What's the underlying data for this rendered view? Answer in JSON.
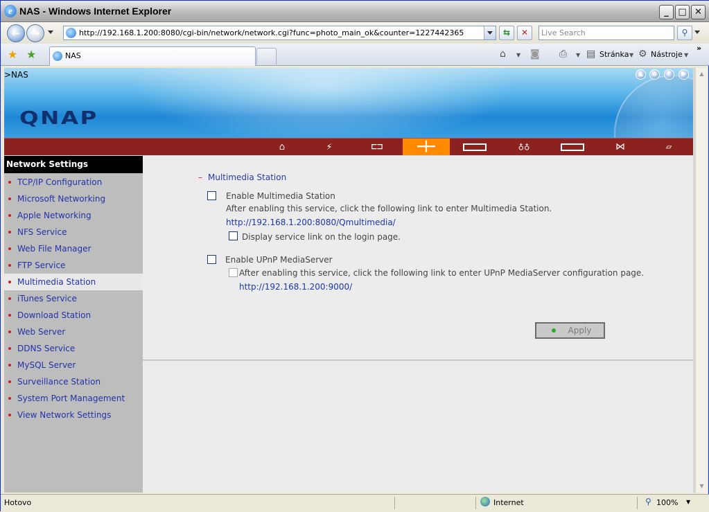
{
  "window": {
    "title": "NAS - Windows Internet Explorer"
  },
  "address": {
    "url": "http://192.168.1.200:8080/cgi-bin/network/network.cgi?func=photo_main_ok&counter=1227442365",
    "search_placeholder": "Live Search"
  },
  "tabs": [
    {
      "label": "NAS"
    }
  ],
  "toolbar": {
    "page_label": "Stránka",
    "tools_label": "Nástroje"
  },
  "banner": {
    "breadcrumb": ">NAS",
    "logo": "QNAP"
  },
  "menu": {
    "items": [
      {
        "icon": "home-icon"
      },
      {
        "icon": "network-icon"
      },
      {
        "icon": "tools-icon"
      },
      {
        "icon": "services-icon",
        "active": true
      },
      {
        "icon": "disk-icon"
      },
      {
        "icon": "users-icon"
      },
      {
        "icon": "folder-icon"
      },
      {
        "icon": "transfer-icon"
      },
      {
        "icon": "report-icon"
      }
    ]
  },
  "sidebar": {
    "heading": "Network Settings",
    "items": [
      "TCP/IP Configuration",
      "Microsoft Networking",
      "Apple Networking",
      "NFS Service",
      "Web File Manager",
      "FTP Service",
      "Multimedia Station",
      "iTunes Service",
      "Download Station",
      "Web Server",
      "DDNS Service",
      "MySQL Server",
      "Surveillance Station",
      "System Port Management",
      "View Network Settings"
    ],
    "selected_index": 6
  },
  "content": {
    "section_title": "Multimedia Station",
    "enable_ms_label": "Enable Multimedia Station",
    "ms_hint": "After enabling this service, click the following link to enter Multimedia Station.",
    "ms_link": "http://192.168.1.200:8080/Qmultimedia/",
    "login_link_label": "Display service link on the login page.",
    "enable_upnp_label": "Enable UPnP MediaServer",
    "upnp_hint": "After enabling this service, click the following link to enter UPnP MediaServer configuration page.",
    "upnp_link": "http://192.168.1.200:9000/",
    "apply_label": "Apply"
  },
  "status": {
    "text": "Hotovo",
    "zone": "Internet",
    "zoom": "100%"
  },
  "colors": {
    "menubar": "#8b2220",
    "active_menu": "#ff8a00",
    "link": "#1a35b0"
  }
}
